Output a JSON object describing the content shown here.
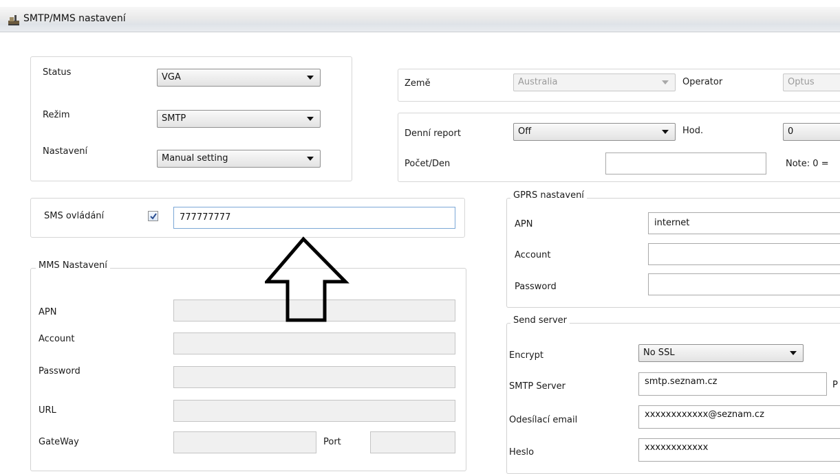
{
  "window": {
    "title": "SMTP/MMS nastavení"
  },
  "top_left": {
    "status": {
      "label": "Status",
      "value": "VGA"
    },
    "mode": {
      "label": "Režim",
      "value": "SMTP"
    },
    "setting": {
      "label": "Nastavení",
      "value": "Manual setting"
    }
  },
  "country_row": {
    "country_label": "Země",
    "country_value": "Australia",
    "operator_label": "Operator",
    "operator_value": "Optus"
  },
  "report": {
    "daily_label": "Denní report",
    "daily_value": "Off",
    "hour_label": "Hod.",
    "hour_value": "0",
    "count_label": "Počet/Den",
    "count_value": "",
    "note": "Note: 0 ="
  },
  "sms_control": {
    "label": "SMS ovládání",
    "checked": true,
    "value": "777777777"
  },
  "mms": {
    "legend": "MMS Nastavení",
    "apn_label": "APN",
    "apn_value": "",
    "account_label": "Account",
    "account_value": "",
    "password_label": "Password",
    "password_value": "",
    "url_label": "URL",
    "url_value": "",
    "gateway_label": "GateWay",
    "gateway_value": "",
    "port_label": "Port",
    "port_value": ""
  },
  "gprs": {
    "legend": "GPRS nastavení",
    "apn_label": "APN",
    "apn_value": "internet",
    "account_label": "Account",
    "account_value": "",
    "password_label": "Password",
    "password_value": ""
  },
  "send_server": {
    "legend": "Send server",
    "encrypt_label": "Encrypt",
    "encrypt_value": "No SSL",
    "smtp_label": "SMTP Server",
    "smtp_value": "smtp.seznam.cz",
    "port_label_cut": "P",
    "sender_label": "Odesílací email",
    "sender_value": "xxxxxxxxxxxx@seznam.cz",
    "password_label": "Heslo",
    "password_value": "xxxxxxxxxxxx"
  },
  "annotation": {
    "arrow": "up-arrow-outline"
  }
}
